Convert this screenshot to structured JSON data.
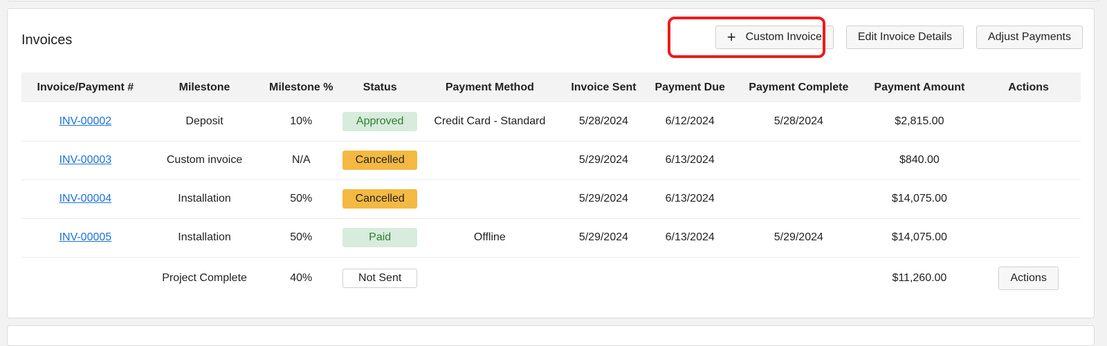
{
  "panel": {
    "title": "Invoices",
    "toolbar": {
      "custom_invoice_label": "Custom Invoice",
      "edit_invoice_label": "Edit Invoice Details",
      "adjust_payments_label": "Adjust Payments"
    }
  },
  "colors": {
    "link": "#1a73d6",
    "approved_bg": "#d7ecdc",
    "cancelled_bg": "#f4b942",
    "highlight": "#ee1b1b"
  },
  "table": {
    "headers": [
      "Invoice/Payment #",
      "Milestone",
      "Milestone %",
      "Status",
      "Payment Method",
      "Invoice Sent",
      "Payment Due",
      "Payment Complete",
      "Payment Amount",
      "Actions"
    ],
    "rows": [
      {
        "invoice": "INV-00002",
        "milestone": "Deposit",
        "pct": "10%",
        "status": "Approved",
        "method": "Credit Card - Standard",
        "sent": "5/28/2024",
        "due": "6/12/2024",
        "complete": "5/28/2024",
        "amount": "$2,815.00"
      },
      {
        "invoice": "INV-00003",
        "milestone": "Custom invoice",
        "pct": "N/A",
        "status": "Cancelled",
        "method": "",
        "sent": "5/29/2024",
        "due": "6/13/2024",
        "complete": "",
        "amount": "$840.00"
      },
      {
        "invoice": "INV-00004",
        "milestone": "Installation",
        "pct": "50%",
        "status": "Cancelled",
        "method": "",
        "sent": "5/29/2024",
        "due": "6/13/2024",
        "complete": "",
        "amount": "$14,075.00"
      },
      {
        "invoice": "INV-00005",
        "milestone": "Installation",
        "pct": "50%",
        "status": "Paid",
        "method": "Offline",
        "sent": "5/29/2024",
        "due": "6/13/2024",
        "complete": "5/29/2024",
        "amount": "$14,075.00"
      },
      {
        "invoice": "",
        "milestone": "Project Complete",
        "pct": "40%",
        "status": "Not Sent",
        "method": "",
        "sent": "",
        "due": "",
        "complete": "",
        "amount": "$11,260.00",
        "action_label": "Actions"
      }
    ]
  }
}
